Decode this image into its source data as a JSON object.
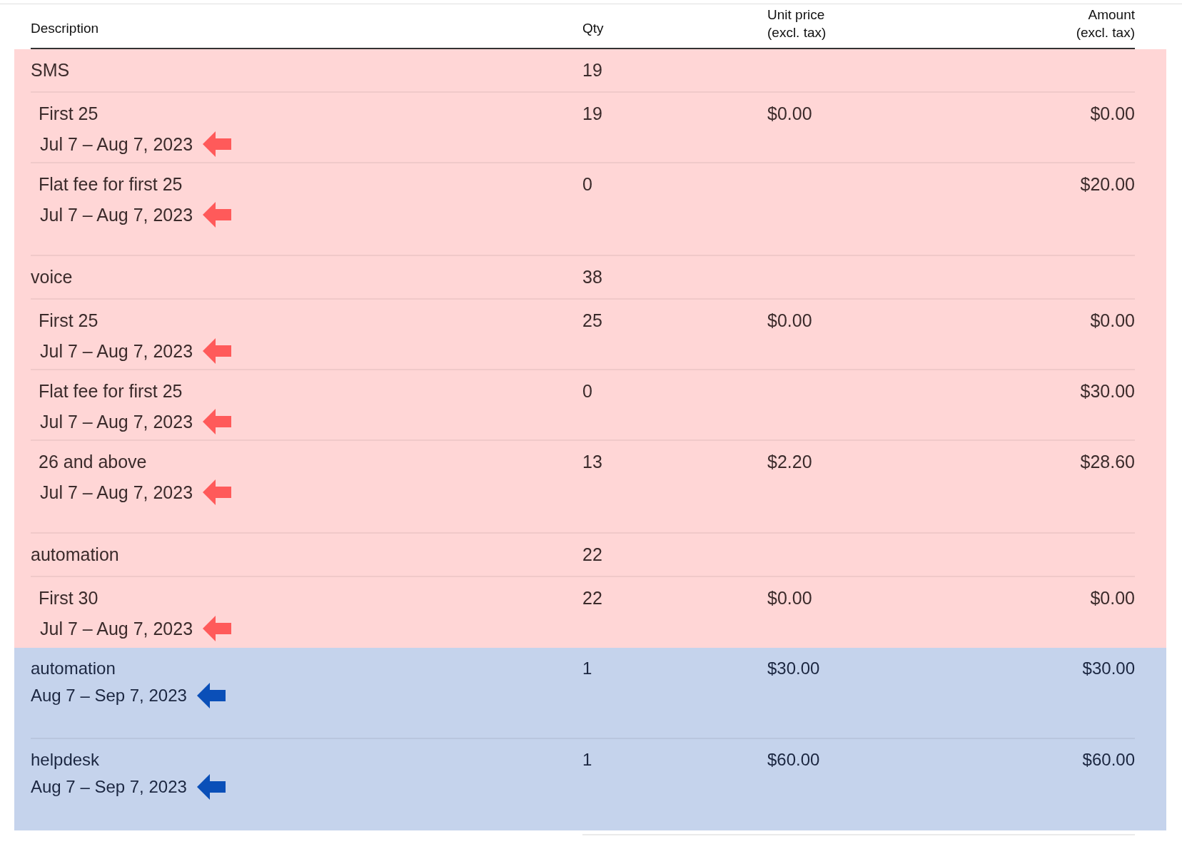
{
  "table": {
    "columns": [
      "Description",
      "Qty",
      "Unit price\n(excl. tax)",
      "Amount\n(excl. tax)"
    ],
    "sections": [
      {
        "kind": "usage",
        "color": "#ffd6d6",
        "rows": [
          {
            "kind": "group",
            "description": "SMS",
            "qty": "19"
          },
          {
            "kind": "tier",
            "description": "First 25",
            "period": "Jul 7 – Aug 7, 2023",
            "qty": "19",
            "unit_price": "$0.00",
            "amount": "$0.00"
          },
          {
            "kind": "tier",
            "description": "Flat fee for first 25",
            "period": "Jul 7 – Aug 7, 2023",
            "qty": "0",
            "amount": "$20.00"
          },
          {
            "kind": "group",
            "description": "voice",
            "qty": "38"
          },
          {
            "kind": "tier",
            "description": "First 25",
            "period": "Jul 7 – Aug 7, 2023",
            "qty": "25",
            "unit_price": "$0.00",
            "amount": "$0.00"
          },
          {
            "kind": "tier",
            "description": "Flat fee for first 25",
            "period": "Jul 7 – Aug 7, 2023",
            "qty": "0",
            "amount": "$30.00"
          },
          {
            "kind": "tier",
            "description": "26 and above",
            "period": "Jul 7 – Aug 7, 2023",
            "qty": "13",
            "unit_price": "$2.20",
            "amount": "$28.60"
          },
          {
            "kind": "group",
            "description": "automation",
            "qty": "22"
          },
          {
            "kind": "tier",
            "description": "First 30",
            "period": "Jul 7 – Aug 7, 2023",
            "qty": "22",
            "unit_price": "$0.00",
            "amount": "$0.00"
          }
        ]
      },
      {
        "kind": "subscription",
        "color": "#c5d3ec",
        "rows": [
          {
            "kind": "item",
            "description": "automation",
            "period": "Aug 7 – Sep 7, 2023",
            "qty": "1",
            "unit_price": "$30.00",
            "amount": "$30.00"
          },
          {
            "kind": "item",
            "description": "helpdesk",
            "period": "Aug 7 – Sep 7, 2023",
            "qty": "1",
            "unit_price": "$60.00",
            "amount": "$60.00"
          }
        ]
      }
    ]
  }
}
